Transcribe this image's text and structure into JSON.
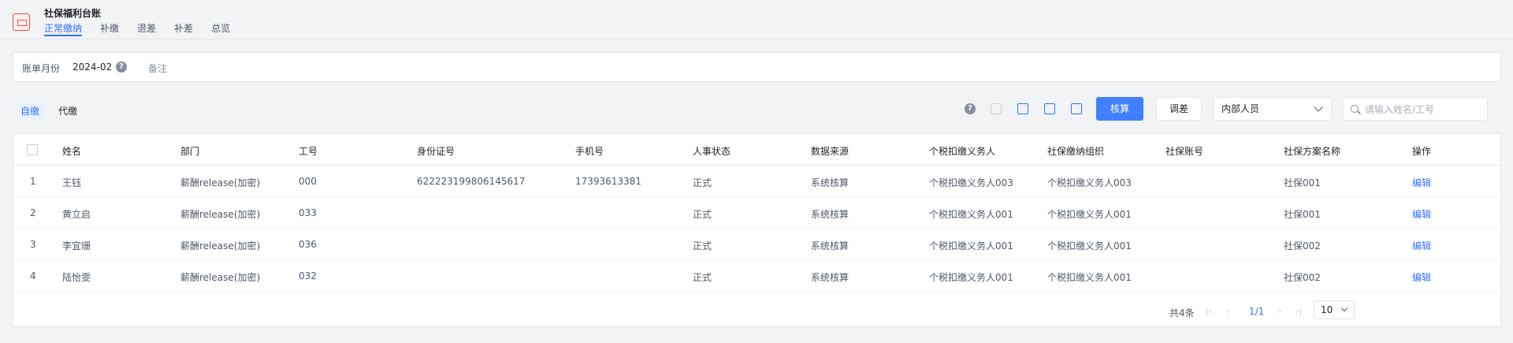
{
  "app": {
    "title": "社保福利台账"
  },
  "tabs": [
    {
      "label": "正常缴纳",
      "active": true
    },
    {
      "label": "补缴",
      "active": false
    },
    {
      "label": "退差",
      "active": false
    },
    {
      "label": "补差",
      "active": false
    },
    {
      "label": "总览",
      "active": false
    }
  ],
  "filter": {
    "month_label": "账单月份",
    "month_value": "2024-02",
    "note_label": "备注"
  },
  "segment": {
    "options": [
      "自缴",
      "代缴"
    ],
    "active": "自缴"
  },
  "toolbar": {
    "calculate_label": "核算",
    "adjust_label": "调差",
    "staff_select_value": "内部人员",
    "search_placeholder": "请输入姓名/工号",
    "icons": [
      "help-icon",
      "copy-icon",
      "import-icon",
      "export-icon",
      "batch-icon"
    ]
  },
  "table": {
    "columns": [
      "姓名",
      "部门",
      "工号",
      "身份证号",
      "手机号",
      "人事状态",
      "数据来源",
      "个税扣缴义务人",
      "社保缴纳组织",
      "社保账号",
      "社保方案名称",
      "操作"
    ],
    "rows": [
      {
        "index": "1",
        "name": "王钰",
        "dept": "薪酬release(加密)",
        "emp_no": "000",
        "id_no": "622223199806145617",
        "phone": "17393613381",
        "hr_status": "正式",
        "source": "系统核算",
        "tax_agent": "个税扣缴义务人003",
        "ss_org": "个税扣缴义务人003",
        "ss_account": "",
        "ss_plan": "社保001",
        "action": "编辑"
      },
      {
        "index": "2",
        "name": "黄立启",
        "dept": "薪酬release(加密)",
        "emp_no": "033",
        "id_no": "",
        "phone": "",
        "hr_status": "正式",
        "source": "系统核算",
        "tax_agent": "个税扣缴义务人001",
        "ss_org": "个税扣缴义务人001",
        "ss_account": "",
        "ss_plan": "社保001",
        "action": "编辑"
      },
      {
        "index": "3",
        "name": "李宜珊",
        "dept": "薪酬release(加密)",
        "emp_no": "036",
        "id_no": "",
        "phone": "",
        "hr_status": "正式",
        "source": "系统核算",
        "tax_agent": "个税扣缴义务人001",
        "ss_org": "个税扣缴义务人001",
        "ss_account": "",
        "ss_plan": "社保002",
        "action": "编辑"
      },
      {
        "index": "4",
        "name": "陆怡雯",
        "dept": "薪酬release(加密)",
        "emp_no": "032",
        "id_no": "",
        "phone": "",
        "hr_status": "正式",
        "source": "系统核算",
        "tax_agent": "个税扣缴义务人001",
        "ss_org": "个税扣缴义务人001",
        "ss_account": "",
        "ss_plan": "社保002",
        "action": "编辑"
      }
    ]
  },
  "pagination": {
    "total_text": "共4条",
    "page_text": "1/1",
    "page_size": "10"
  },
  "colors": {
    "primary": "#3370ff",
    "button_primary": "#4080ff",
    "danger": "#f54a45"
  }
}
